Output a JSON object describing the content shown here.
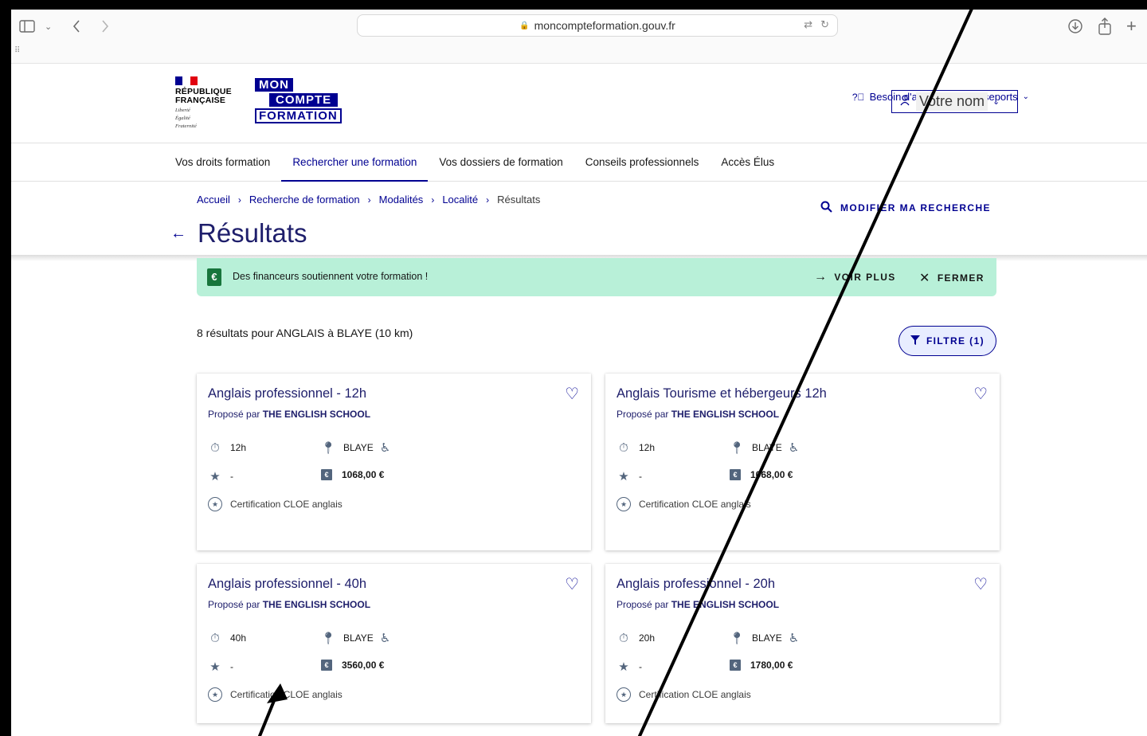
{
  "browser": {
    "url": "moncompteformation.gouv.fr"
  },
  "header": {
    "rf": [
      "RÉPUBLIQUE",
      "FRANÇAISE"
    ],
    "motto": [
      "Liberté",
      "Égalité",
      "Fraternité"
    ],
    "logo": [
      "MON",
      "COMPTE",
      "FORMATION"
    ],
    "help_label": "Besoin d'aide",
    "passports_label": "Passeports",
    "user_name": "Votre nom"
  },
  "nav": {
    "items": [
      {
        "label": "Vos droits formation"
      },
      {
        "label": "Rechercher une formation"
      },
      {
        "label": "Vos dossiers de formation"
      },
      {
        "label": "Conseils professionnels"
      },
      {
        "label": "Accès Élus"
      }
    ]
  },
  "breadcrumb": {
    "items": [
      "Accueil",
      "Recherche de formation",
      "Modalités",
      "Localité"
    ],
    "current": "Résultats"
  },
  "modify_search_label": "MODIFIER MA RECHERCHE",
  "page_title": "Résultats",
  "banner": {
    "text": "Des financeurs soutiennent votre formation !",
    "more_label": "VOIR PLUS",
    "close_label": "FERMER"
  },
  "results": {
    "count_text": "8 résultats pour ANGLAIS à BLAYE (10 km)",
    "filter_label": "FILTRE (1)",
    "provider_prefix": "Proposé par",
    "cards": [
      {
        "title": "Anglais professionnel - 12h",
        "provider": "THE ENGLISH SCHOOL",
        "duration": "12h",
        "location": "BLAYE",
        "rating": "-",
        "price": "1068,00 €",
        "certification": "Certification CLOE anglais"
      },
      {
        "title": "Anglais Tourisme et hébergeurs 12h",
        "provider": "THE ENGLISH SCHOOL",
        "duration": "12h",
        "location": "BLAYE",
        "rating": "-",
        "price": "1068,00 €",
        "certification": "Certification CLOE anglais"
      },
      {
        "title": "Anglais professionnel - 40h",
        "provider": "THE ENGLISH SCHOOL",
        "duration": "40h",
        "location": "BLAYE",
        "rating": "-",
        "price": "3560,00 €",
        "certification": "Certification CLOE anglais"
      },
      {
        "title": "Anglais professionnel - 20h",
        "provider": "THE ENGLISH SCHOOL",
        "duration": "20h",
        "location": "BLAYE",
        "rating": "-",
        "price": "1780,00 €",
        "certification": "Certification CLOE anglais"
      }
    ]
  },
  "colors": {
    "accent": "#000091",
    "banner_bg": "#b8f0d8",
    "annotation": "#000000"
  }
}
